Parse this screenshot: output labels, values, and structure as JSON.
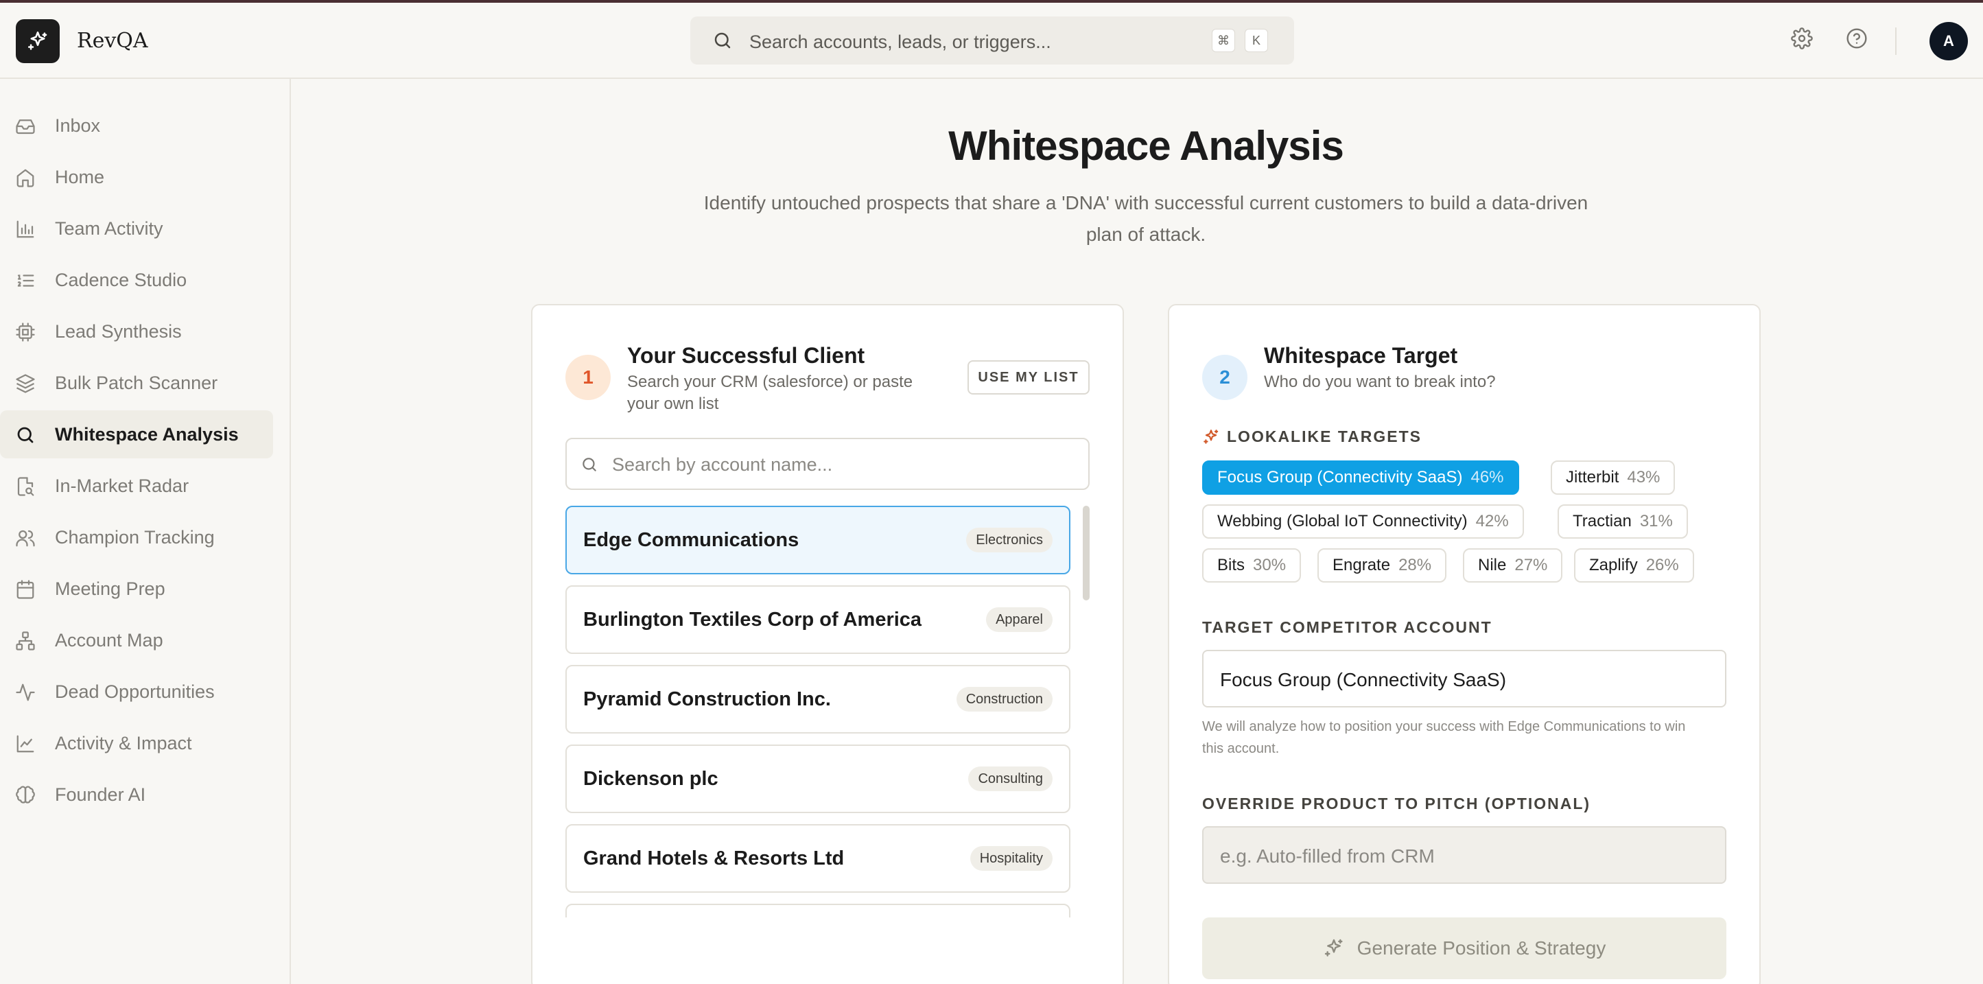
{
  "app": {
    "name": "RevQA",
    "avatar_initial": "A"
  },
  "search": {
    "placeholder": "Search accounts, leads, or triggers...",
    "kbd": [
      "⌘",
      "K"
    ]
  },
  "sidebar": {
    "items": [
      {
        "label": "Inbox",
        "icon": "inbox-icon"
      },
      {
        "label": "Home",
        "icon": "home-icon"
      },
      {
        "label": "Team Activity",
        "icon": "bar-chart-icon"
      },
      {
        "label": "Cadence Studio",
        "icon": "list-ordered-icon"
      },
      {
        "label": "Lead Synthesis",
        "icon": "cpu-icon"
      },
      {
        "label": "Bulk Patch Scanner",
        "icon": "layers-icon"
      },
      {
        "label": "Whitespace Analysis",
        "icon": "search-icon",
        "active": true
      },
      {
        "label": "In-Market Radar",
        "icon": "file-search-icon"
      },
      {
        "label": "Champion Tracking",
        "icon": "users-icon"
      },
      {
        "label": "Meeting Prep",
        "icon": "calendar-icon"
      },
      {
        "label": "Account Map",
        "icon": "network-icon"
      },
      {
        "label": "Dead Opportunities",
        "icon": "activity-icon"
      },
      {
        "label": "Activity & Impact",
        "icon": "line-chart-icon"
      },
      {
        "label": "Founder AI",
        "icon": "brain-icon"
      }
    ]
  },
  "page": {
    "title": "Whitespace Analysis",
    "subtitle": "Identify untouched prospects that share a 'DNA' with successful current customers to build a data-driven plan of attack."
  },
  "client_card": {
    "step": "1",
    "title": "Your Successful Client",
    "subtitle": "Search your CRM (salesforce) or paste your own list",
    "use_list_button": "USE MY LIST",
    "search_placeholder": "Search by account name...",
    "accounts": [
      {
        "name": "Edge Communications",
        "industry": "Electronics",
        "selected": true
      },
      {
        "name": "Burlington Textiles Corp of America",
        "industry": "Apparel"
      },
      {
        "name": "Pyramid Construction Inc.",
        "industry": "Construction"
      },
      {
        "name": "Dickenson plc",
        "industry": "Consulting"
      },
      {
        "name": "Grand Hotels & Resorts Ltd",
        "industry": "Hospitality"
      }
    ]
  },
  "target_card": {
    "step": "2",
    "title": "Whitespace Target",
    "subtitle": "Who do you want to break into?",
    "lookalike_label": "LOOKALIKE TARGETS",
    "lookalikes": [
      {
        "name": "Focus Group (Connectivity SaaS)",
        "pct": "46%",
        "selected": true
      },
      {
        "name": "Jitterbit",
        "pct": "43%"
      },
      {
        "name": "Webbing (Global IoT Connectivity)",
        "pct": "42%"
      },
      {
        "name": "Tractian",
        "pct": "31%"
      },
      {
        "name": "Bits",
        "pct": "30%"
      },
      {
        "name": "Engrate",
        "pct": "28%"
      },
      {
        "name": "Nile",
        "pct": "27%"
      },
      {
        "name": "Zaplify",
        "pct": "26%"
      }
    ],
    "competitor_label": "TARGET COMPETITOR ACCOUNT",
    "competitor_value": "Focus Group (Connectivity SaaS)",
    "competitor_hint": "We will analyze how to position your success with Edge Communications to win this account.",
    "override_label": "OVERRIDE PRODUCT TO PITCH (OPTIONAL)",
    "override_placeholder": "e.g. Auto-filled from CRM",
    "generate_button": "Generate Position & Strategy"
  },
  "colors": {
    "accent": "#0fa0e4",
    "brand_dark": "#1d1d1d",
    "step1": "#e0562a",
    "step2": "#2b8fd6"
  }
}
